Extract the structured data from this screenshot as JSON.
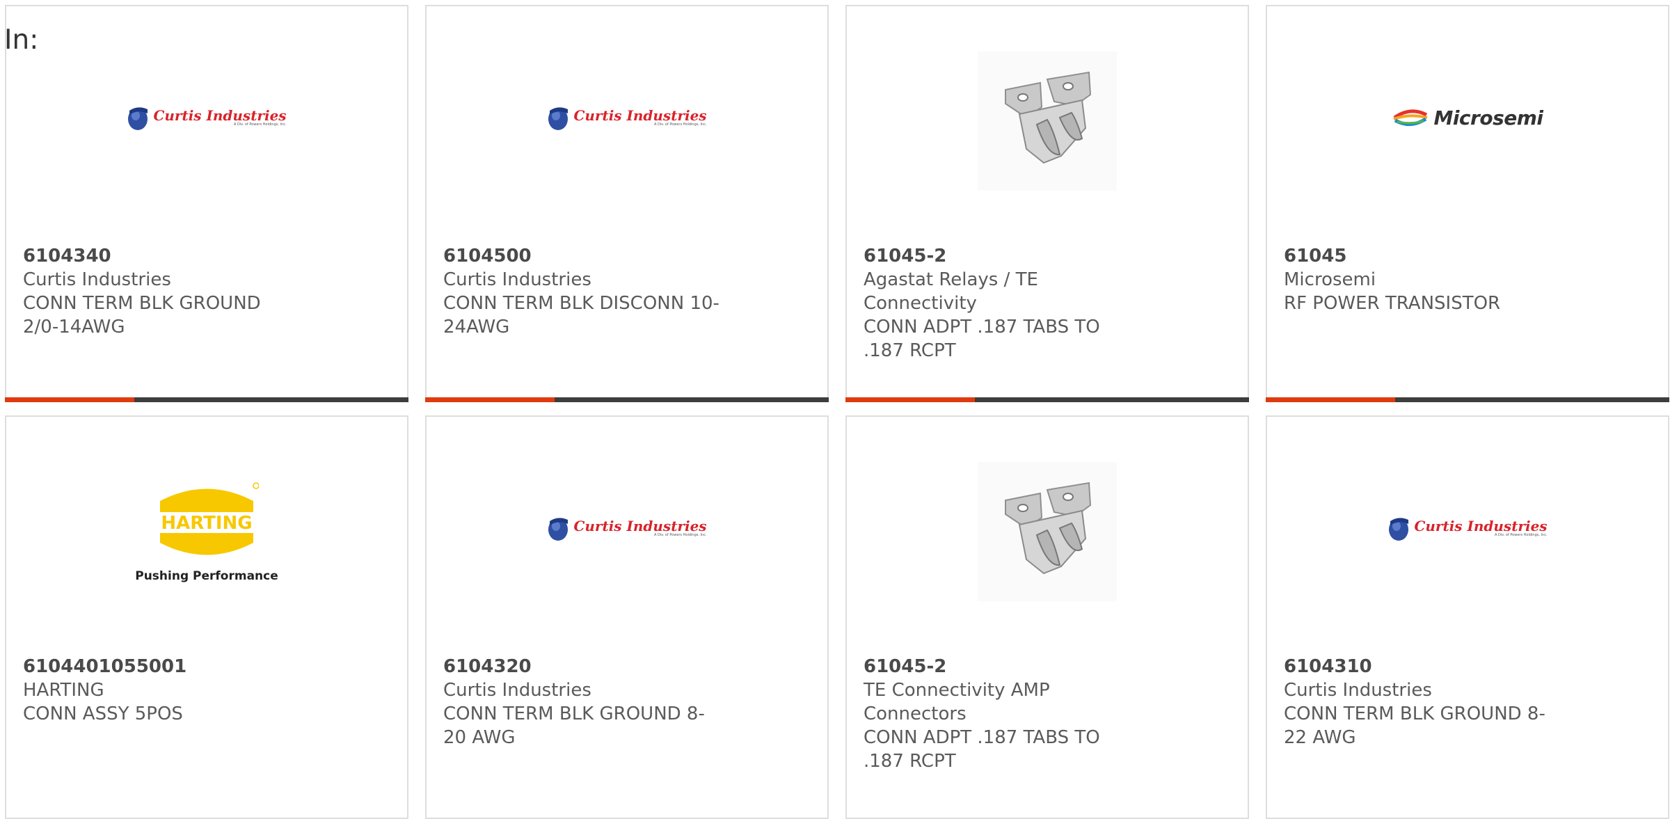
{
  "filter": {
    "label": "In:"
  },
  "colors": {
    "accent": "#e03a10",
    "progress_track": "#3d3d3d",
    "card_border": "#dedede",
    "text": "#5a5a5a"
  },
  "products": [
    {
      "part_number": "6104340",
      "manufacturer": "Curtis Industries",
      "description": "CONN TERM BLK GROUND 2/0-14AWG",
      "image": "curtis-industries-logo",
      "logo_text": "Curtis Industries",
      "logo_subtext": "A Div. of Powers Holdings, Inc.",
      "progress": 0.32
    },
    {
      "part_number": "6104500",
      "manufacturer": "Curtis Industries",
      "description": "CONN TERM BLK DISCONN 10-24AWG",
      "image": "curtis-industries-logo",
      "logo_text": "Curtis Industries",
      "logo_subtext": "A Div. of Powers Holdings, Inc.",
      "progress": 0.32
    },
    {
      "part_number": "61045-2",
      "manufacturer": "Agastat Relays / TE Connectivity",
      "description": "CONN ADPT .187 TABS TO .187 RCPT",
      "image": "connector-adapter-photo",
      "progress": 0.32
    },
    {
      "part_number": "61045",
      "manufacturer": "Microsemi",
      "description": "RF POWER TRANSISTOR",
      "image": "microsemi-logo",
      "logo_text": "Microsemi",
      "progress": 0.32
    },
    {
      "part_number": "6104401055001",
      "manufacturer": "HARTING",
      "description": "CONN ASSY 5POS",
      "image": "harting-logo",
      "logo_text": "HARTING",
      "logo_tagline": "Pushing Performance"
    },
    {
      "part_number": "6104320",
      "manufacturer": "Curtis Industries",
      "description": "CONN TERM BLK GROUND 8-20 AWG",
      "image": "curtis-industries-logo",
      "logo_text": "Curtis Industries",
      "logo_subtext": "A Div. of Powers Holdings, Inc."
    },
    {
      "part_number": "61045-2",
      "manufacturer": "TE Connectivity AMP Connectors",
      "description": "CONN ADPT .187 TABS TO .187 RCPT",
      "image": "connector-adapter-photo"
    },
    {
      "part_number": "6104310",
      "manufacturer": "Curtis Industries",
      "description": "CONN TERM BLK GROUND 8-22 AWG",
      "image": "curtis-industries-logo",
      "logo_text": "Curtis Industries",
      "logo_subtext": "A Div. of Powers Holdings, Inc."
    }
  ]
}
